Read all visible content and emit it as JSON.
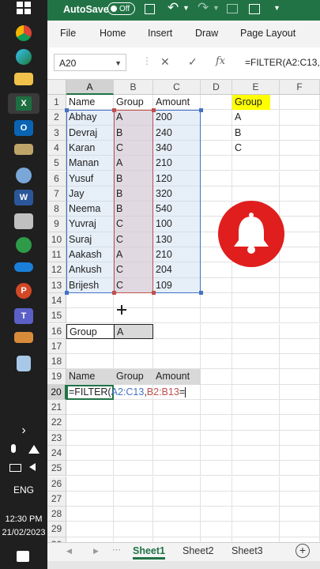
{
  "taskbar": {
    "language": "ENG",
    "time": "12:30 PM",
    "date": "21/02/2023"
  },
  "titlebar": {
    "autosave_label": "AutoSave",
    "autosave_state": "Off"
  },
  "ribbon": {
    "tabs": [
      "File",
      "Home",
      "Insert",
      "Draw",
      "Page Layout"
    ]
  },
  "formula_bar": {
    "name_box": "A20",
    "fx": "fx",
    "formula": "=FILTER(A2:C13,"
  },
  "grid": {
    "columns": [
      "A",
      "B",
      "C",
      "D",
      "E",
      "F"
    ],
    "rows": [
      "1",
      "2",
      "3",
      "4",
      "5",
      "6",
      "7",
      "8",
      "9",
      "10",
      "11",
      "12",
      "13",
      "14",
      "15",
      "16",
      "17",
      "18",
      "19",
      "20",
      "21",
      "22",
      "23",
      "24",
      "25",
      "26",
      "27",
      "28",
      "29",
      "30"
    ],
    "table_header": [
      "Name",
      "Group",
      "Amount"
    ],
    "table_rows": [
      [
        "Abhay",
        "A",
        "200"
      ],
      [
        "Devraj",
        "B",
        "240"
      ],
      [
        "Karan",
        "C",
        "340"
      ],
      [
        "Manan",
        "A",
        "210"
      ],
      [
        "Yusuf",
        "B",
        "120"
      ],
      [
        "Jay",
        "B",
        "320"
      ],
      [
        "Neema",
        "B",
        "540"
      ],
      [
        "Yuvraj",
        "C",
        "100"
      ],
      [
        "Suraj",
        "C",
        "130"
      ],
      [
        "Aakash",
        "A",
        "210"
      ],
      [
        "Ankush",
        "C",
        "204"
      ],
      [
        "Brijesh",
        "C",
        "109"
      ]
    ],
    "group_list_header": "Group",
    "group_list": [
      "A",
      "B",
      "C"
    ],
    "criteria_label": "Group",
    "criteria_value": "A",
    "output_header": [
      "Name",
      "Group",
      "Amount"
    ],
    "edit_formula_parts": [
      "=FILTER(",
      "A2:C13",
      ",",
      "B2:B13",
      "="
    ]
  },
  "sheets": {
    "tabs": [
      "Sheet1",
      "Sheet2",
      "Sheet3"
    ],
    "add": "+"
  },
  "colors": {
    "excel_green": "#217346",
    "highlight_yellow": "#ffff00",
    "range_blue": "#4472c4",
    "range_red": "#c0504d",
    "bell_red": "#e01e1e"
  }
}
